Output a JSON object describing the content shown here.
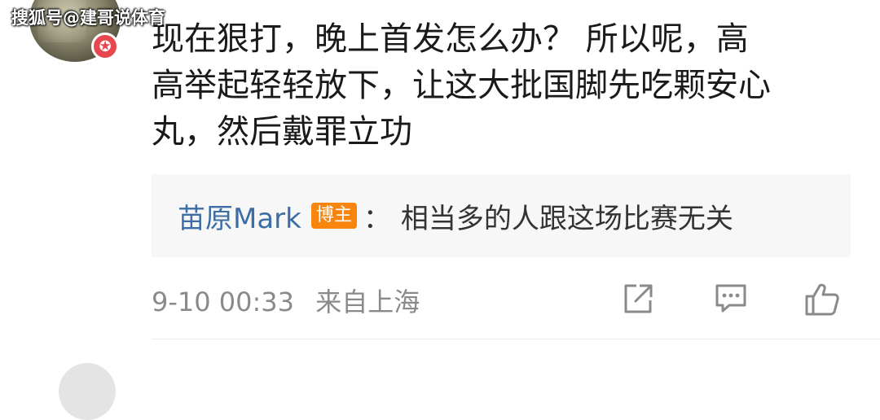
{
  "watermark": "搜狐号@建哥说体育",
  "comment": {
    "lines": [
      "现在狠打，晚上首发怎么办？ 所以呢，高",
      "高举起轻轻放下，让这大批国脚先吃颗安心",
      "丸，然后戴罪立功"
    ]
  },
  "quote": {
    "author": "苗原Mark",
    "tag": "博主",
    "separator": "：",
    "text": "相当多的人跟这场比赛无关"
  },
  "meta": {
    "time": "9-10 00:33",
    "source": "来自上海"
  },
  "actions": {
    "icons": [
      "share-icon",
      "comment-icon",
      "like-icon"
    ]
  },
  "colors": {
    "author_link": "#3c6ea5",
    "tag_bg": "#f7850e",
    "badge": "#e8474f"
  }
}
